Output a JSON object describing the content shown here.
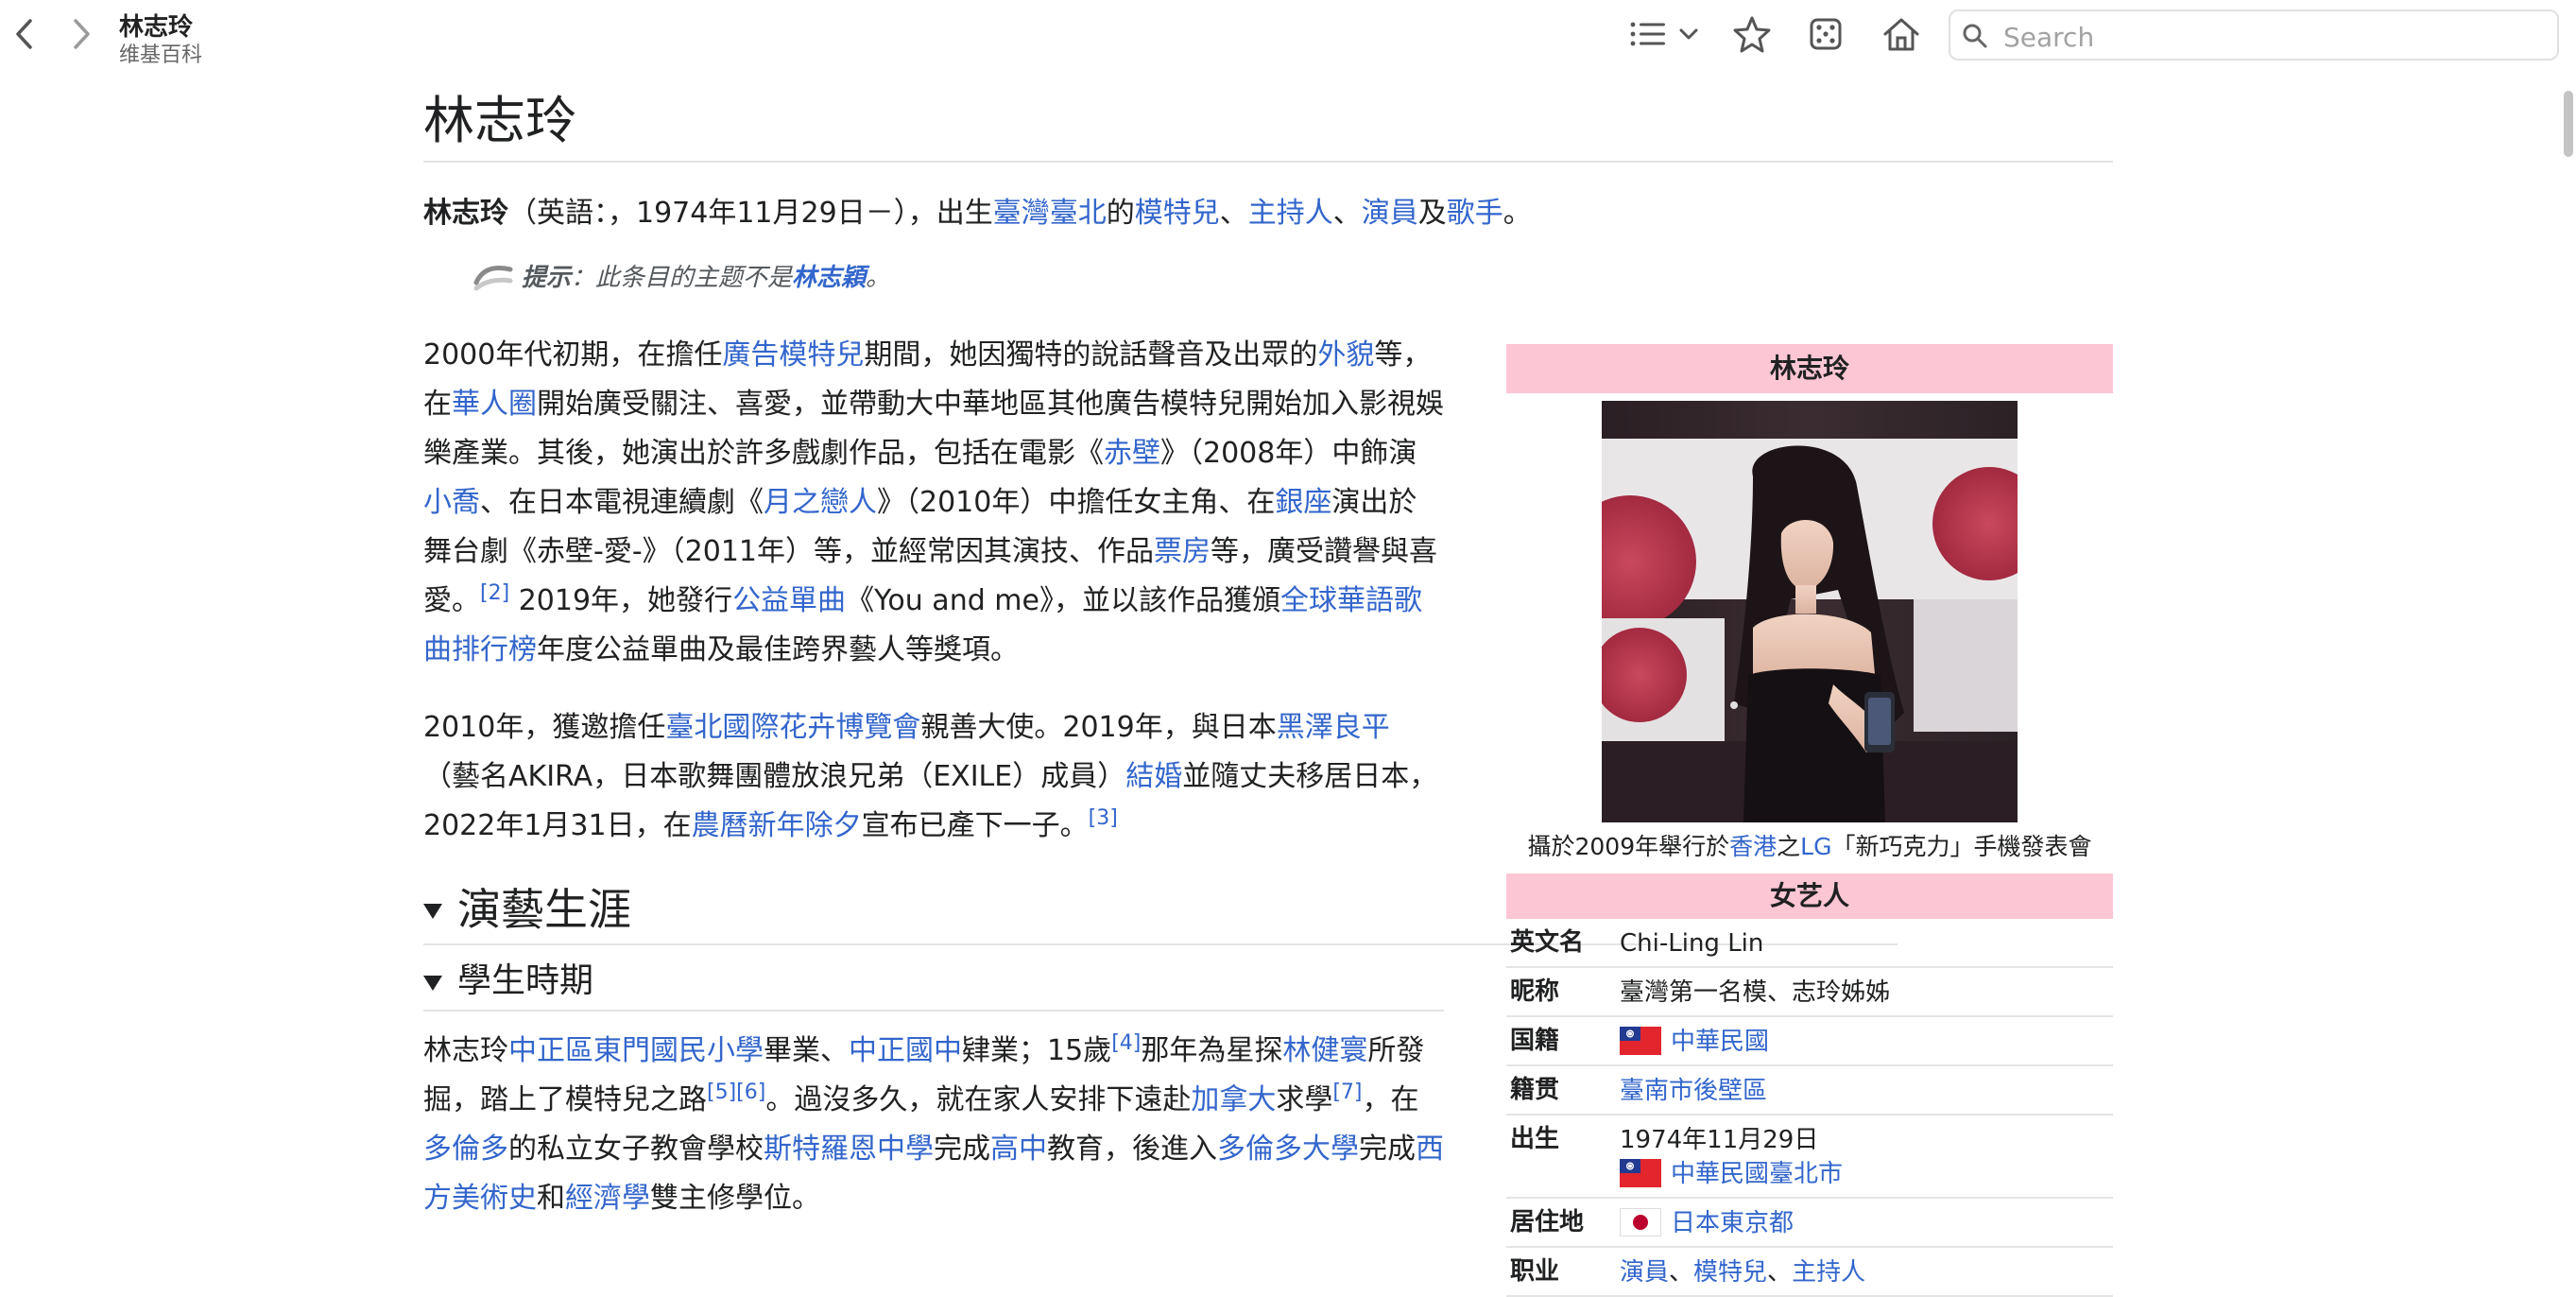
{
  "toolbar": {
    "app_title": "林志玲",
    "app_subtitle": "维基百科",
    "search_placeholder": "Search"
  },
  "article": {
    "title": "林志玲",
    "lead": {
      "name": "林志玲",
      "t1": "（英語：，1974年11月29日－），出生",
      "link_taiwan_taipei": "臺灣臺北",
      "t2": "的",
      "link_model": "模特兒",
      "sep1": "、",
      "link_host": "主持人",
      "sep2": "、",
      "link_actor": "演員",
      "t3": "及",
      "link_singer": "歌手",
      "t4": "。"
    },
    "hatnote": {
      "prefix": "提示",
      "text": "：此条目的主题不是",
      "link": "林志穎",
      "suffix": "。"
    },
    "para1": {
      "t1": "2000年代初期，在擔任",
      "l1": "廣告模特兒",
      "t2": "期間，她因獨特的說話聲音及出眾的",
      "l2": "外貌",
      "t3": "等，在",
      "l3": "華人圈",
      "t4": "開始廣受關注、喜愛，並帶動大中華地區其他廣告模特兒開始加入影視娛樂產業。其後，她演出於許多戲劇作品，包括在電影《",
      "l4": "赤壁",
      "t5": "》（2008年）中飾演",
      "l5": "小喬",
      "t6": "、在日本電視連續劇《",
      "l6": "月之戀人",
      "t7": "》（2010年）中擔任女主角、在",
      "l7": "銀座",
      "t8": "演出於舞台劇《赤壁-愛-》（2011年）等，並經常因其演技、作品",
      "l8": "票房",
      "t9": "等，廣受讚譽與喜愛。",
      "ref1": "[2]",
      "t10": " 2019年，她發行",
      "l9": "公益單曲",
      "t11": "《You and me》，並以該作品獲頒",
      "l10": "全球華語歌曲排行榜",
      "t12": "年度公益單曲及最佳跨界藝人等獎項。"
    },
    "para2": {
      "t1": "2010年，獲邀擔任",
      "l1": "臺北國際花卉博覽會",
      "t2": "親善大使。2019年，與日本",
      "l2": "黑澤良平",
      "t3": "（藝名AKIRA，日本歌舞團體放浪兄弟（EXILE）成員）",
      "l3": "結婚",
      "t4": "並隨丈夫移居日本，2022年1月31日，在",
      "l4": "農曆新年除夕",
      "t5": "宣布已產下一子。",
      "ref1": "[3]"
    },
    "section_career": "演藝生涯",
    "subsection_student": "學生時期",
    "para3": {
      "t1": "林志玲",
      "l1": "中正區東門國民小學",
      "t2": "畢業、",
      "l2": "中正國中",
      "t3": "肄業；15歲",
      "ref1": "[4]",
      "t4": "那年為星探",
      "l3": "林健寰",
      "t5": "所發掘，踏上了模特兒之路",
      "ref2": "[5]",
      "ref3": "[6]",
      "t6": "。過沒多久，就在家人安排下遠赴",
      "l4": "加拿大",
      "t7": "求學",
      "ref4": "[7]",
      "t8": "，在",
      "l5": "多倫多",
      "t9": "的私立女子教會學校",
      "l6": "斯特羅恩中學",
      "t10": "完成",
      "l7": "高中",
      "t11": "教育，後進入",
      "l8": "多倫多大學",
      "t12": "完成",
      "l9": "西方美術史",
      "t13": "和",
      "l10": "經濟學",
      "t14": "雙主修學位。"
    }
  },
  "infobox": {
    "header": "林志玲",
    "caption": {
      "t1": "攝於2009年舉行於",
      "l1": "香港",
      "t2": "之",
      "l2": "LG",
      "t3": "「新巧克力」手機發表會"
    },
    "subheader": "女艺人",
    "rows": {
      "english_name": {
        "label": "英文名",
        "value": "Chi-Ling Lin"
      },
      "nickname": {
        "label": "昵称",
        "value": "臺灣第一名模、志玲姊姊"
      },
      "nationality": {
        "label": "国籍",
        "value": "中華民國"
      },
      "ancestry": {
        "label": "籍贯",
        "value": "臺南市後壁區"
      },
      "born": {
        "label": "出生",
        "date": "1974年11月29日",
        "place": "中華民國臺北市"
      },
      "residence": {
        "label": "居住地",
        "value": "日本東京都"
      },
      "occupation": {
        "label": "职业",
        "v1": "演員",
        "sep1": "、",
        "v2": "模特兒",
        "sep2": "、",
        "v3": "主持人"
      }
    }
  },
  "colors": {
    "link": "#3366cc",
    "infobox_header": "#fcc6d4",
    "text": "#202122"
  }
}
